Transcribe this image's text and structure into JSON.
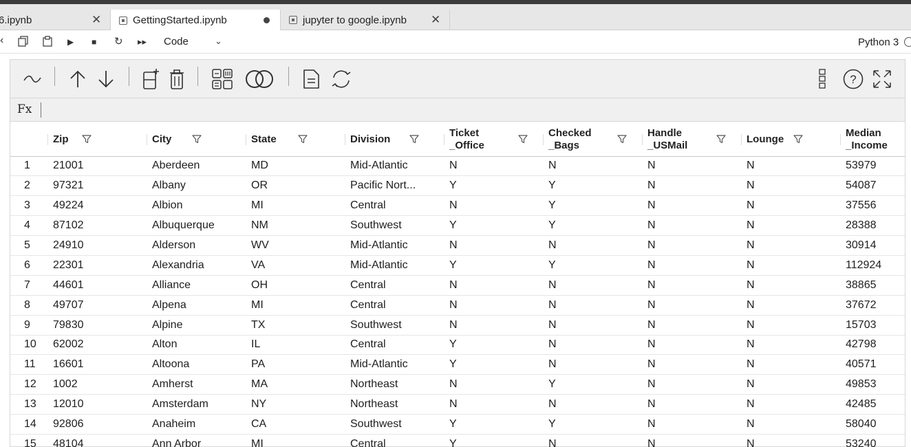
{
  "tabs": [
    {
      "label": "6.ipynb"
    },
    {
      "label": "GettingStarted.ipynb"
    },
    {
      "label": "jupyter to google.ipynb"
    }
  ],
  "notebook_toolbar": {
    "cell_type": "Code",
    "kernel": "Python 3"
  },
  "widget": {
    "formula_label": "Fx"
  },
  "table": {
    "columns": [
      {
        "label": "",
        "filter": false
      },
      {
        "label": "Zip",
        "filter": true
      },
      {
        "label": "City",
        "filter": true
      },
      {
        "label": "State",
        "filter": true
      },
      {
        "label": "Division",
        "filter": true
      },
      {
        "label": "Ticket _Office",
        "filter": true
      },
      {
        "label": "Checked _Bags",
        "filter": true
      },
      {
        "label": "Handle _USMail",
        "filter": true
      },
      {
        "label": "Lounge",
        "filter": true
      },
      {
        "label": "Median _Income",
        "filter": false
      }
    ],
    "rows": [
      [
        "1",
        "21001",
        "Aberdeen",
        "MD",
        "Mid-Atlantic",
        "N",
        "N",
        "N",
        "N",
        "53979"
      ],
      [
        "2",
        "97321",
        "Albany",
        "OR",
        "Pacific Nort...",
        "Y",
        "Y",
        "N",
        "N",
        "54087"
      ],
      [
        "3",
        "49224",
        "Albion",
        "MI",
        "Central",
        "N",
        "Y",
        "N",
        "N",
        "37556"
      ],
      [
        "4",
        "87102",
        "Albuquerque",
        "NM",
        "Southwest",
        "Y",
        "Y",
        "N",
        "N",
        "28388"
      ],
      [
        "5",
        "24910",
        "Alderson",
        "WV",
        "Mid-Atlantic",
        "N",
        "N",
        "N",
        "N",
        "30914"
      ],
      [
        "6",
        "22301",
        "Alexandria",
        "VA",
        "Mid-Atlantic",
        "Y",
        "Y",
        "N",
        "N",
        "112924"
      ],
      [
        "7",
        "44601",
        "Alliance",
        "OH",
        "Central",
        "N",
        "N",
        "N",
        "N",
        "38865"
      ],
      [
        "8",
        "49707",
        "Alpena",
        "MI",
        "Central",
        "N",
        "N",
        "N",
        "N",
        "37672"
      ],
      [
        "9",
        "79830",
        "Alpine",
        "TX",
        "Southwest",
        "N",
        "N",
        "N",
        "N",
        "15703"
      ],
      [
        "10",
        "62002",
        "Alton",
        "IL",
        "Central",
        "Y",
        "N",
        "N",
        "N",
        "42798"
      ],
      [
        "11",
        "16601",
        "Altoona",
        "PA",
        "Mid-Atlantic",
        "Y",
        "N",
        "N",
        "N",
        "40571"
      ],
      [
        "12",
        "1002",
        "Amherst",
        "MA",
        "Northeast",
        "N",
        "Y",
        "N",
        "N",
        "49853"
      ],
      [
        "13",
        "12010",
        "Amsterdam",
        "NY",
        "Northeast",
        "N",
        "N",
        "N",
        "N",
        "42485"
      ],
      [
        "14",
        "92806",
        "Anaheim",
        "CA",
        "Southwest",
        "Y",
        "Y",
        "N",
        "N",
        "58040"
      ],
      [
        "15",
        "48104",
        "Ann Arbor",
        "MI",
        "Central",
        "Y",
        "N",
        "N",
        "N",
        "53240"
      ]
    ]
  }
}
